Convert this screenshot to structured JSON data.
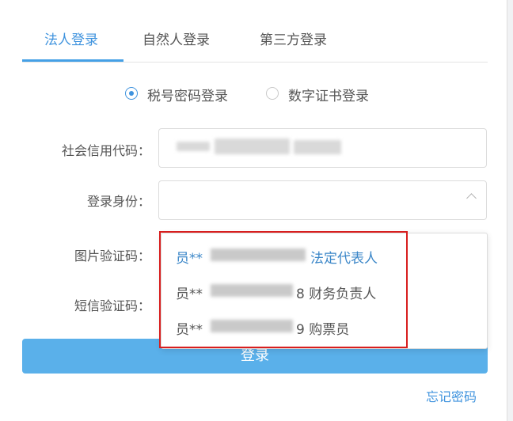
{
  "tabs": [
    {
      "label": "法人登录",
      "active": true
    },
    {
      "label": "自然人登录",
      "active": false
    },
    {
      "label": "第三方登录",
      "active": false
    }
  ],
  "login_mode": {
    "options": [
      {
        "label": "税号密码登录",
        "checked": true
      },
      {
        "label": "数字证书登录",
        "checked": false
      }
    ]
  },
  "form": {
    "credit_code_label": "社会信用代码：",
    "identity_label": "登录身份：",
    "captcha_label": "图片验证码：",
    "sms_label": "短信验证码："
  },
  "identity_options": [
    {
      "prefix": "员**",
      "suffix": "法定代表人",
      "selected": true
    },
    {
      "prefix": "员**",
      "suffix": "8 财务负责人",
      "selected": false
    },
    {
      "prefix": "员**",
      "suffix": "9 购票员",
      "selected": false
    }
  ],
  "login_button": "登录",
  "forgot_password": "忘记密码",
  "colors": {
    "accent": "#3f93de",
    "button": "#5ab0ea",
    "highlight": "#d81e1e"
  }
}
